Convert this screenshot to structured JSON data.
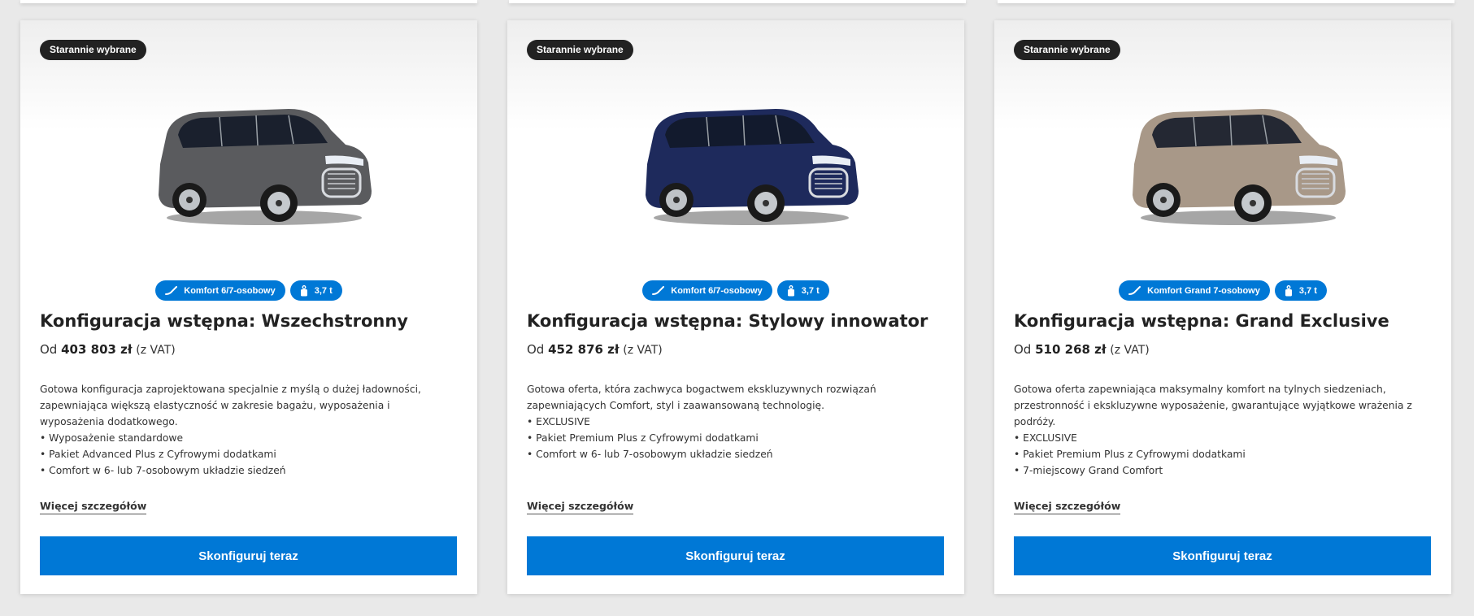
{
  "cards": [
    {
      "badge": "Starannie wybrane",
      "car_color": "#5a5b5e",
      "chips": [
        {
          "icon": "seat-icon",
          "label": "Komfort 6/7-osobowy"
        },
        {
          "icon": "weight-icon",
          "label": "3,7 t"
        }
      ],
      "title": "Konfiguracja wstępna: Wszechstronny",
      "price_prefix": "Od",
      "price_amount": "403 803 zł",
      "price_vat": "(z VAT)",
      "description_lines": [
        "Gotowa konfiguracja zaprojektowana specjalnie z myślą o dużej ładowności,",
        "zapewniająca większą elastyczność w zakresie bagażu, wyposażenia i",
        "wyposażenia dodatkowego."
      ],
      "bullets": [
        "Wyposażenie standardowe",
        "Pakiet Advanced Plus z Cyfrowymi dodatkami",
        "Comfort w 6- lub 7-osobowym układzie siedzeń"
      ],
      "more_link": "Więcej szczegółów",
      "cta": "Skonfiguruj teraz"
    },
    {
      "badge": "Starannie wybrane",
      "car_color": "#1e2a5c",
      "chips": [
        {
          "icon": "seat-icon",
          "label": "Komfort 6/7-osobowy"
        },
        {
          "icon": "weight-icon",
          "label": "3,7 t"
        }
      ],
      "title": "Konfiguracja wstępna: Stylowy innowator",
      "price_prefix": "Od",
      "price_amount": "452 876 zł",
      "price_vat": "(z VAT)",
      "description_lines": [
        "Gotowa oferta, która zachwyca bogactwem ekskluzywnych rozwiązań",
        "zapewniających Comfort, styl i zaawansowaną technologię."
      ],
      "bullets": [
        "EXCLUSIVE",
        "Pakiet Premium Plus z Cyfrowymi dodatkami",
        "Comfort w 6- lub 7-osobowym układzie siedzeń"
      ],
      "more_link": "Więcej szczegółów",
      "cta": "Skonfiguruj teraz"
    },
    {
      "badge": "Starannie wybrane",
      "car_color": "#a89888",
      "chips": [
        {
          "icon": "seat-icon",
          "label": "Komfort Grand 7-osobowy"
        },
        {
          "icon": "weight-icon",
          "label": "3,7 t"
        }
      ],
      "title": "Konfiguracja wstępna: Grand Exclusive",
      "price_prefix": "Od",
      "price_amount": "510 268 zł",
      "price_vat": "(z VAT)",
      "description_lines": [
        "Gotowa oferta zapewniająca maksymalny komfort na tylnych siedzeniach,",
        "przestronność i ekskluzywne wyposażenie, gwarantujące wyjątkowe wrażenia z",
        "podróży."
      ],
      "bullets": [
        "EXCLUSIVE",
        "Pakiet Premium Plus z Cyfrowymi dodatkami",
        "7-miejscowy Grand Comfort"
      ],
      "more_link": "Więcej szczegółów",
      "cta": "Skonfiguruj teraz"
    }
  ],
  "colors": {
    "accent": "#0078d6",
    "badge_bg": "#222222",
    "page_bg": "#e9e9e9"
  }
}
